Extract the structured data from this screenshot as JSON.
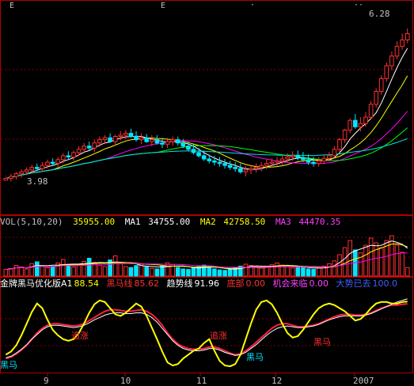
{
  "colors": {
    "background": "#000000",
    "up": "#ff3030",
    "down": "#00e5ff",
    "grid": "#b00000",
    "text": "#c0c0c0",
    "ma5": "#ffffff",
    "ma10": "#ffff00",
    "ma20": "#ff00ff",
    "ma30": "#00ff00",
    "ma60": "#00e5e5",
    "ind_white": "#ffffff",
    "ind_yellow": "#ffff00",
    "ind_red": "#ff2040",
    "ind_label": "#ff3030",
    "ind_black_horse": "#00e5ff"
  },
  "vol_info": {
    "name": "VOL(5,10,20)",
    "vol": "35955.00",
    "ma1_label": "MA1",
    "ma1": "34755.00",
    "ma2_label": "MA2",
    "ma2": "42758.50",
    "ma3_label": "MA3",
    "ma3": "44470.35"
  },
  "ind_info": {
    "name": "金牌黑马优化版A1",
    "a1": "88.54",
    "heima_label": "黑马线",
    "heima": "85.62",
    "qushi_label": "趋势线",
    "qushi": "91.96",
    "dibu_label": "底部",
    "dibu": "0.00",
    "jihui_label": "机会来临",
    "jihui": "0.00",
    "dabu_label": "大势已去",
    "dabu": "100.0"
  },
  "chart_data": [
    {
      "type": "candlestick",
      "xlabel": "",
      "ylabel": "",
      "ylim": [
        3.5,
        6.5
      ],
      "annotations": [
        {
          "text": "3.98",
          "kind": "low_marker"
        },
        {
          "text": "6.28",
          "kind": "high_marker"
        }
      ],
      "ohlc_open": [
        3.92,
        3.95,
        3.98,
        4.02,
        4.05,
        4.08,
        4.12,
        4.1,
        4.15,
        4.2,
        4.18,
        4.24,
        4.3,
        4.28,
        4.35,
        4.4,
        4.45,
        4.42,
        4.5,
        4.55,
        4.58,
        4.52,
        4.6,
        4.62,
        4.65,
        4.6,
        4.55,
        4.58,
        4.52,
        4.55,
        4.5,
        4.48,
        4.52,
        4.55,
        4.5,
        4.45,
        4.4,
        4.35,
        4.3,
        4.25,
        4.22,
        4.2,
        4.18,
        4.15,
        4.12,
        4.1,
        4.05,
        4.08,
        4.1,
        4.12,
        4.15,
        4.18,
        4.2,
        4.22,
        4.25,
        4.28,
        4.3,
        4.27,
        4.24,
        4.2,
        4.18,
        4.22,
        4.26,
        4.3,
        4.4,
        4.55,
        4.7,
        4.85,
        4.75,
        4.8,
        4.9,
        5.1,
        5.3,
        5.5,
        5.7,
        5.85,
        6.0,
        6.1
      ],
      "ohlc_high": [
        3.99,
        4.02,
        4.05,
        4.09,
        4.12,
        4.16,
        4.18,
        4.2,
        4.24,
        4.26,
        4.28,
        4.34,
        4.37,
        4.38,
        4.45,
        4.5,
        4.52,
        4.55,
        4.6,
        4.62,
        4.65,
        4.63,
        4.68,
        4.7,
        4.72,
        4.68,
        4.65,
        4.64,
        4.62,
        4.62,
        4.58,
        4.58,
        4.6,
        4.6,
        4.56,
        4.52,
        4.48,
        4.42,
        4.38,
        4.32,
        4.3,
        4.28,
        4.25,
        4.22,
        4.2,
        4.18,
        4.14,
        4.16,
        4.18,
        4.2,
        4.24,
        4.26,
        4.28,
        4.3,
        4.34,
        4.37,
        4.38,
        4.36,
        4.32,
        4.28,
        4.28,
        4.32,
        4.36,
        4.45,
        4.58,
        4.72,
        4.88,
        4.95,
        4.9,
        4.98,
        5.15,
        5.35,
        5.55,
        5.75,
        5.92,
        6.08,
        6.2,
        6.28
      ],
      "ohlc_low": [
        3.98,
        3.9,
        3.93,
        3.96,
        4.0,
        4.03,
        4.06,
        4.05,
        4.1,
        4.14,
        4.12,
        4.18,
        4.24,
        4.22,
        4.3,
        4.34,
        4.38,
        4.36,
        4.44,
        4.48,
        4.5,
        4.46,
        4.54,
        4.56,
        4.58,
        4.52,
        4.48,
        4.5,
        4.45,
        4.47,
        4.42,
        4.42,
        4.46,
        4.46,
        4.42,
        4.37,
        4.32,
        4.27,
        4.22,
        4.18,
        4.15,
        4.13,
        4.1,
        4.08,
        4.05,
        4.02,
        3.98,
        4.02,
        4.04,
        4.06,
        4.09,
        4.12,
        4.14,
        4.16,
        4.2,
        4.22,
        4.23,
        4.2,
        4.16,
        4.13,
        4.13,
        4.17,
        4.21,
        4.27,
        4.36,
        4.5,
        4.65,
        4.72,
        4.68,
        4.75,
        4.86,
        5.05,
        5.25,
        5.45,
        5.63,
        5.8,
        5.95,
        6.05
      ],
      "ohlc_close": [
        3.95,
        3.98,
        4.02,
        4.05,
        4.08,
        4.12,
        4.1,
        4.15,
        4.2,
        4.18,
        4.24,
        4.3,
        4.28,
        4.35,
        4.4,
        4.45,
        4.42,
        4.5,
        4.55,
        4.58,
        4.52,
        4.6,
        4.62,
        4.65,
        4.6,
        4.55,
        4.58,
        4.52,
        4.55,
        4.5,
        4.48,
        4.52,
        4.55,
        4.5,
        4.45,
        4.4,
        4.35,
        4.3,
        4.25,
        4.22,
        4.2,
        4.18,
        4.15,
        4.12,
        4.1,
        4.05,
        4.08,
        4.1,
        4.12,
        4.15,
        4.18,
        4.2,
        4.22,
        4.25,
        4.28,
        4.3,
        4.27,
        4.24,
        4.2,
        4.18,
        4.22,
        4.26,
        4.3,
        4.4,
        4.55,
        4.7,
        4.85,
        4.75,
        4.8,
        4.9,
        5.1,
        5.3,
        5.5,
        5.7,
        5.85,
        6.0,
        6.1,
        6.2
      ]
    },
    {
      "type": "bar",
      "xlabel": "",
      "ylabel": "",
      "ylim": [
        0,
        200000
      ],
      "values": [
        28000,
        32000,
        45000,
        38000,
        30000,
        52000,
        60000,
        42000,
        35000,
        40000,
        55000,
        70000,
        48000,
        38000,
        44000,
        62000,
        75000,
        58000,
        46000,
        40000,
        68000,
        85000,
        52000,
        40000,
        36000,
        44000,
        50000,
        38000,
        32000,
        30000,
        42000,
        56000,
        48000,
        36000,
        30000,
        28000,
        34000,
        40000,
        46000,
        38000,
        30000,
        26000,
        24000,
        30000,
        36000,
        42000,
        50000,
        45000,
        38000,
        34000,
        40000,
        48000,
        55000,
        46000,
        38000,
        34000,
        40000,
        36000,
        30000,
        28000,
        34000,
        42000,
        52000,
        64000,
        90000,
        120000,
        150000,
        110000,
        98000,
        130000,
        160000,
        140000,
        120000,
        150000,
        170000,
        130000,
        100000,
        35955
      ]
    },
    {
      "type": "line",
      "xlabel": "",
      "ylabel": "",
      "ylim": [
        0,
        100
      ],
      "series": [
        {
          "name": "金牌黑马优化版A1",
          "values": [
            20,
            24,
            32,
            45,
            60,
            75,
            86,
            80,
            65,
            52,
            45,
            40,
            38,
            40,
            48,
            60,
            74,
            85,
            90,
            88,
            80,
            72,
            70,
            74,
            80,
            86,
            82,
            70,
            55,
            40,
            24,
            10,
            6,
            8,
            15,
            20,
            25,
            28,
            35,
            40,
            25,
            12,
            6,
            5,
            8,
            20,
            40,
            60,
            78,
            88,
            90,
            85,
            74,
            60,
            48,
            42,
            44,
            52,
            62,
            72,
            80,
            84,
            86,
            84,
            80,
            76,
            70,
            64,
            66,
            72,
            80,
            86,
            88,
            88,
            86,
            86,
            88,
            88.54
          ]
        },
        {
          "name": "黑马线",
          "values": [
            15,
            17,
            21,
            26,
            32,
            40,
            48,
            54,
            58,
            60,
            60,
            59,
            58,
            57,
            58,
            60,
            64,
            68,
            72,
            76,
            78,
            78,
            77,
            76,
            76,
            77,
            78,
            76,
            72,
            66,
            58,
            48,
            40,
            34,
            30,
            28,
            27,
            27,
            28,
            30,
            30,
            28,
            25,
            22,
            20,
            21,
            25,
            30,
            36,
            42,
            48,
            54,
            58,
            60,
            60,
            58,
            56,
            56,
            57,
            58,
            60,
            63,
            66,
            69,
            71,
            72,
            72,
            71,
            71,
            72,
            74,
            77,
            80,
            82,
            84,
            84,
            85,
            85.62
          ]
        },
        {
          "name": "趋势线",
          "values": [
            16,
            18,
            22,
            27,
            33,
            40,
            46,
            52,
            56,
            58,
            58,
            57,
            56,
            55,
            56,
            58,
            61,
            65,
            68,
            71,
            73,
            74,
            74,
            73,
            73,
            74,
            74,
            72,
            68,
            62,
            54,
            46,
            38,
            32,
            28,
            26,
            25,
            25,
            26,
            28,
            28,
            26,
            23,
            21,
            19,
            20,
            23,
            28,
            33,
            39,
            45,
            50,
            54,
            56,
            57,
            56,
            55,
            55,
            56,
            57,
            59,
            62,
            65,
            67,
            69,
            70,
            70,
            70,
            70,
            71,
            73,
            76,
            79,
            82,
            85,
            88,
            90,
            91.96
          ]
        }
      ],
      "annotations": [
        {
          "text": "追涨"
        },
        {
          "text": "追涨"
        },
        {
          "text": "黑马"
        },
        {
          "text": "黑马"
        },
        {
          "text": "黑马"
        }
      ]
    }
  ],
  "axis": {
    "x_ticks": [
      "9",
      "10",
      "11",
      "12",
      "2007"
    ],
    "top_markers": [
      "E",
      "E"
    ]
  }
}
